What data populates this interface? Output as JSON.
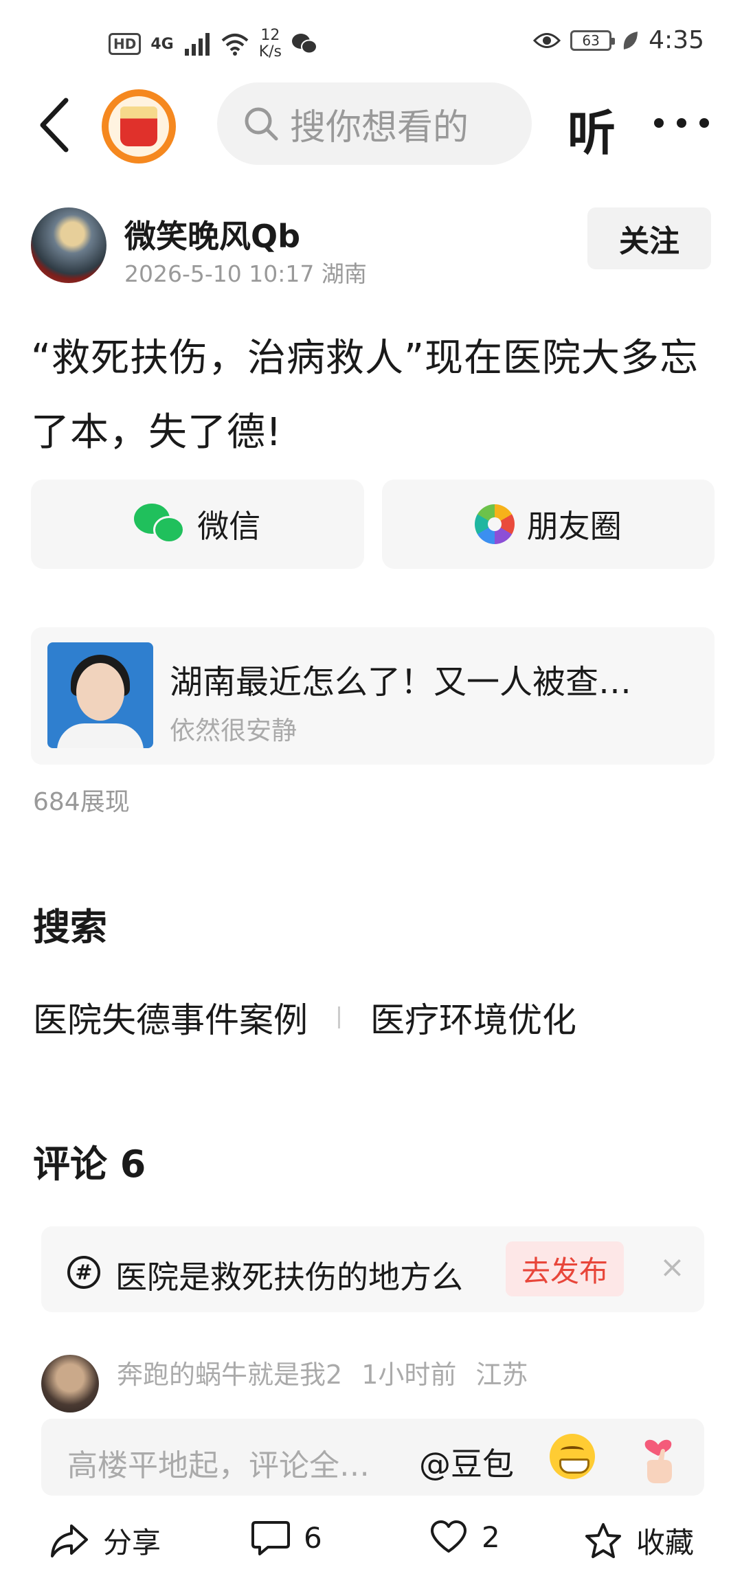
{
  "status_bar": {
    "hd": "HD",
    "network": "4G",
    "speed_value": "12",
    "speed_unit": "K/s",
    "battery": "63",
    "time": "4:35"
  },
  "header": {
    "search_placeholder": "搜你想看的",
    "listen_label": "听"
  },
  "author": {
    "name": "微笑晚风Qb",
    "datetime": "2026-5-10 10:17",
    "location": "湖南",
    "follow_label": "关注"
  },
  "post": {
    "title": "“救死扶伤，治病救人”现在医院大多忘了本，失了德!"
  },
  "share": {
    "wechat_label": "微信",
    "moments_label": "朋友圈"
  },
  "related": {
    "title": "湖南最近怎么了！又一人被查…",
    "source": "依然很安静"
  },
  "views": "684展现",
  "search_section": {
    "title": "搜索",
    "tags": [
      "医院失德事件案例",
      "医疗环境优化"
    ]
  },
  "comments_section": {
    "title": "评论 6"
  },
  "topic_prompt": {
    "text": "医院是救死扶伤的地方么",
    "publish_label": "去发布",
    "close_symbol": "×"
  },
  "comment": {
    "user": "奔跑的蜗牛就是我2",
    "time": "1小时前",
    "location": "江苏"
  },
  "input_bar": {
    "placeholder": "高楼平地起，评论全…",
    "mention": "@豆包"
  },
  "bottom_bar": {
    "share_label": "分享",
    "comment_count": "6",
    "like_count": "2",
    "favorite_label": "收藏"
  },
  "colors": {
    "accent_red": "#e8463a",
    "wechat_green": "#20c05c",
    "logo_orange": "#f5881f"
  }
}
